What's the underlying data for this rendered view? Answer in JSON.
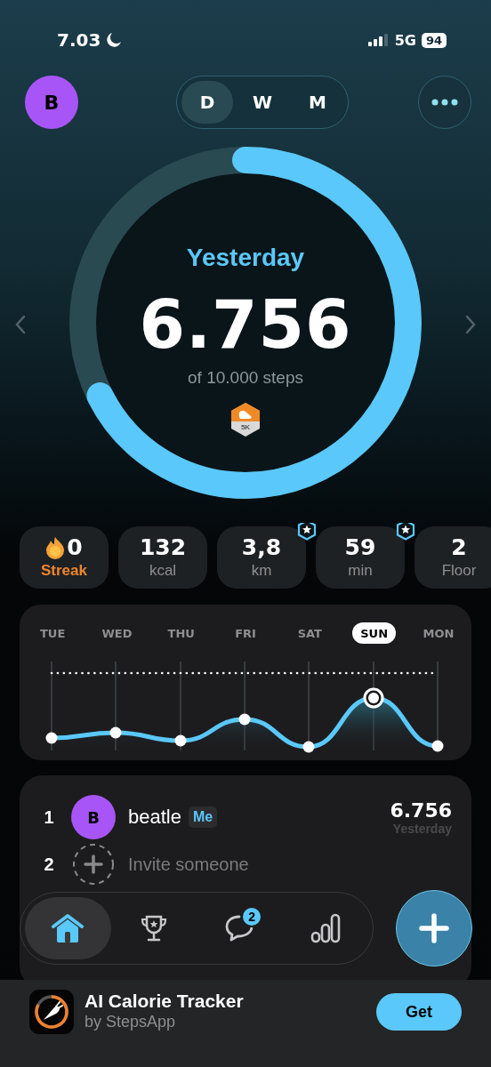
{
  "status_bar": {
    "time": "7.03",
    "network": "5G",
    "battery": "94"
  },
  "header": {
    "avatar": "B",
    "periods": [
      {
        "label": "D",
        "selected": true
      },
      {
        "label": "W",
        "selected": false
      },
      {
        "label": "M",
        "selected": false
      }
    ]
  },
  "ring": {
    "level": 0.6756,
    "label": "Yesterday",
    "value": "6.756",
    "goal": "of 10.000 steps",
    "badge": "5K"
  },
  "stats": [
    {
      "kind": "streak",
      "value": "0",
      "label": "Streak",
      "starred": false
    },
    {
      "kind": "metric",
      "value": "132",
      "label": "kcal",
      "starred": false
    },
    {
      "kind": "metric",
      "value": "3,8",
      "label": "km",
      "starred": true
    },
    {
      "kind": "metric",
      "value": "59",
      "label": "min",
      "starred": true
    },
    {
      "kind": "metric",
      "value": "2",
      "label": "Floor",
      "starred": false
    }
  ],
  "chart": {
    "days": [
      {
        "label": "TUE",
        "selected": false
      },
      {
        "label": "WED",
        "selected": false
      },
      {
        "label": "THU",
        "selected": false
      },
      {
        "label": "FRI",
        "selected": false
      },
      {
        "label": "SAT",
        "selected": false
      },
      {
        "label": "SUN",
        "selected": true
      },
      {
        "label": "MON",
        "selected": false
      }
    ]
  },
  "leaderboard": [
    {
      "kind": "member",
      "rank": "1",
      "avatar": "B",
      "name": "beatle",
      "tag": "Me",
      "steps": "6.756",
      "period": "Yesterday"
    },
    {
      "kind": "invite",
      "rank": "2",
      "name": "Invite someone"
    }
  ],
  "tab_bar": [
    {
      "kind": "home",
      "selected": true
    },
    {
      "kind": "trophy",
      "selected": false
    },
    {
      "kind": "chat",
      "selected": false,
      "badge": "2"
    },
    {
      "kind": "stats",
      "selected": false
    }
  ],
  "ad": {
    "title": "AI Calorie Tracker",
    "by": "by StepsApp",
    "button": "Get"
  }
}
